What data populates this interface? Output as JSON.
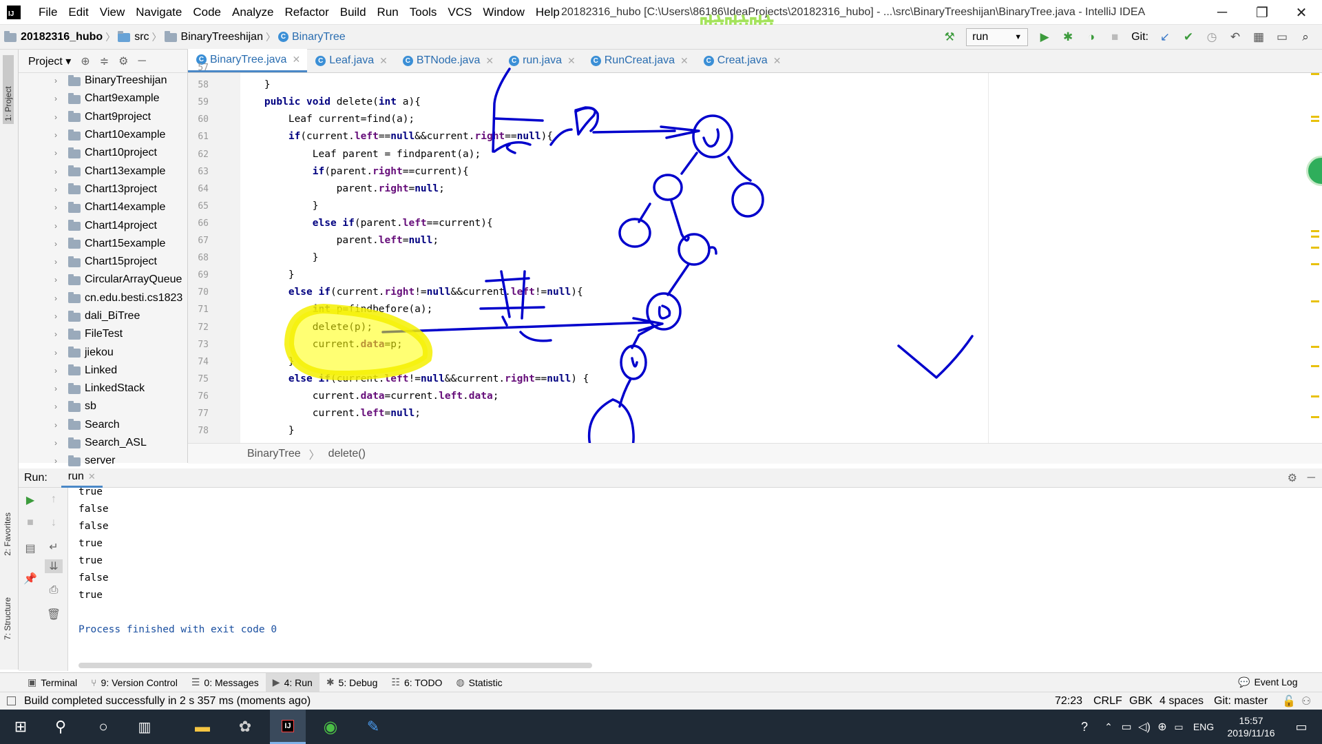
{
  "menu": [
    "File",
    "Edit",
    "View",
    "Navigate",
    "Code",
    "Analyze",
    "Refactor",
    "Build",
    "Run",
    "Tools",
    "VCS",
    "Window",
    "Help"
  ],
  "window_title": "20182316_hubo [C:\\Users\\86186\\IdeaProjects\\20182316_hubo] - ...\\src\\BinaryTreeshijan\\BinaryTree.java - IntelliJ IDEA",
  "watermark": "啦啦啦",
  "navbar": {
    "project": "20182316_hubo",
    "src": "src",
    "package": "BinaryTreeshijan",
    "cls": "BinaryTree"
  },
  "toolbar": {
    "run_config": "run",
    "git_label": "Git:"
  },
  "left_strip": {
    "project": "1: Project",
    "favorites": "2: Favorites",
    "structure": "7: Structure"
  },
  "project_panel": {
    "title": "Project",
    "items": [
      "BinaryTreeshijan",
      "Chart9example",
      "Chart9project",
      "Chart10example",
      "Chart10project",
      "Chart13example",
      "Chart13project",
      "Chart14example",
      "Chart14project",
      "Chart15example",
      "Chart15project",
      "CircularArrayQueue",
      "cn.edu.besti.cs1823",
      "dali_BiTree",
      "FileTest",
      "jiekou",
      "Linked",
      "LinkedStack",
      "sb",
      "Search",
      "Search_ASL",
      "server"
    ]
  },
  "tabs": [
    "BinaryTree.java",
    "Leaf.java",
    "BTNode.java",
    "run.java",
    "RunCreat.java",
    "Creat.java"
  ],
  "code": {
    "line_numbers": [
      "57",
      "58",
      "59",
      "60",
      "61",
      "62",
      "63",
      "64",
      "65",
      "66",
      "67",
      "68",
      "69",
      "70",
      "71",
      "72",
      "73",
      "74",
      "75",
      "76",
      "77",
      "78"
    ],
    "lines": [
      "        return false;",
      "    }",
      "    public void delete(int a){",
      "        Leaf current=find(a);",
      "        if(current.left==null&&current.right==null){",
      "            Leaf parent = findparent(a);",
      "            if(parent.right==current){",
      "                parent.right=null;",
      "            }",
      "            else if(parent.left==current){",
      "                parent.left=null;",
      "            }",
      "        }",
      "        else if(current.right!=null&&current.left!=null){",
      "            int p=findbefore(a);",
      "            delete(p);",
      "            current.data=p;",
      "        }",
      "        else if(current.left!=null&&current.right==null) {",
      "            current.data=current.left.data;",
      "            current.left=null;",
      "        }"
    ]
  },
  "editor_breadcrumb": {
    "cls": "BinaryTree",
    "method": "delete()"
  },
  "run_panel": {
    "label": "Run:",
    "tab": "run"
  },
  "console": [
    "true",
    "false",
    "false",
    "true",
    "true",
    "false",
    "true",
    "",
    "Process finished with exit code 0"
  ],
  "bottom_tabs": [
    "Terminal",
    "9: Version Control",
    "0: Messages",
    "4: Run",
    "5: Debug",
    "6: TODO",
    "Statistic"
  ],
  "event_log": "Event Log",
  "status": {
    "message": "Build completed successfully in 2 s 357 ms (moments ago)",
    "position": "72:23",
    "line_sep": "CRLF",
    "encoding": "GBK",
    "indent": "4 spaces",
    "git": "Git: master"
  },
  "taskbar": {
    "lang": "ENG",
    "time": "15:57",
    "date": "2019/11/16"
  },
  "colors": {
    "keyword": "#000080",
    "field": "#660e7a",
    "annotation_ink": "#0000cc",
    "highlight": "#ffff00"
  }
}
